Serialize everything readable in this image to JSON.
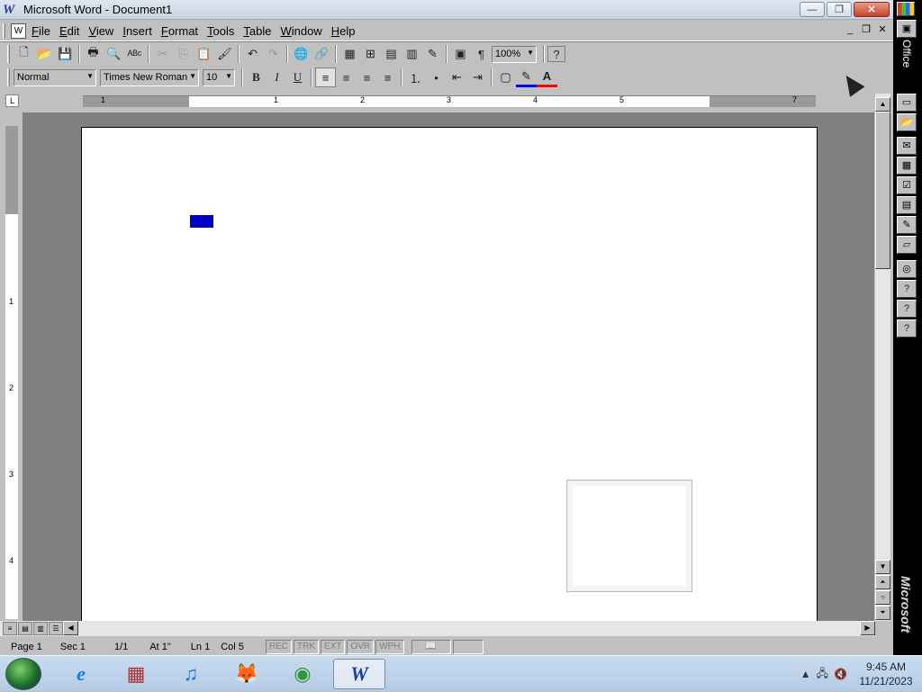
{
  "window": {
    "title": "Microsoft Word - Document1"
  },
  "titlebar_buttons": {
    "minimize": "—",
    "restore": "❐",
    "close": "✕"
  },
  "menu": [
    "File",
    "Edit",
    "View",
    "Insert",
    "Format",
    "Tools",
    "Table",
    "Window",
    "Help"
  ],
  "doc_controls": {
    "minimize": "_",
    "restore": "❐",
    "close": "✕"
  },
  "standard_toolbar": {
    "new": "🗋",
    "open": "📂",
    "save": "💾",
    "print": "🖶",
    "preview": "🔍",
    "spell": "ᴬᴮᶜ",
    "cut": "✂",
    "copy": "⎘",
    "paste": "📋",
    "format_painter": "🖌",
    "undo": "↶",
    "redo": "↷",
    "web": "🌐",
    "hyperlink": "🔗",
    "tables": "▦",
    "insert_table": "⊞",
    "excel": "▤",
    "columns": "▥",
    "drawing": "✎",
    "doc_map": "▣",
    "show_hide": "¶",
    "zoom": "100%",
    "help": "?"
  },
  "formatting_toolbar": {
    "style": "Normal",
    "font": "Times New Roman",
    "size": "10",
    "bold": "B",
    "italic": "I",
    "underline": "U",
    "align_left": "≡",
    "center": "≡",
    "align_right": "≡",
    "justify": "≡",
    "numbering": "⒈",
    "bullets": "•",
    "dec_indent": "⇤",
    "inc_indent": "⇥",
    "border": "▢",
    "highlight": "✎",
    "font_color": "A"
  },
  "ruler": {
    "tab_selector": "L",
    "marks": [
      "1",
      "1",
      "2",
      "3",
      "4",
      "5",
      "7"
    ]
  },
  "vruler": {
    "marks": [
      "1",
      "2",
      "3",
      "4"
    ]
  },
  "statusbar": {
    "page": "Page  1",
    "sec": "Sec  1",
    "pages": "1/1",
    "at": "At  1\"",
    "ln": "Ln  1",
    "col": "Col  5",
    "rec": "REC",
    "trk": "TRK",
    "ext": "EXT",
    "ovr": "OVR",
    "wph": "WPH",
    "book": "📖"
  },
  "officebar": {
    "label": "Office",
    "brand": "Microsoft"
  },
  "taskbar": {
    "time": "9:45 AM",
    "date": "11/21/2023",
    "ie": "e",
    "media": "▦",
    "music": "♫",
    "firefox": "🦊",
    "chrome": "◉",
    "word": "W"
  }
}
